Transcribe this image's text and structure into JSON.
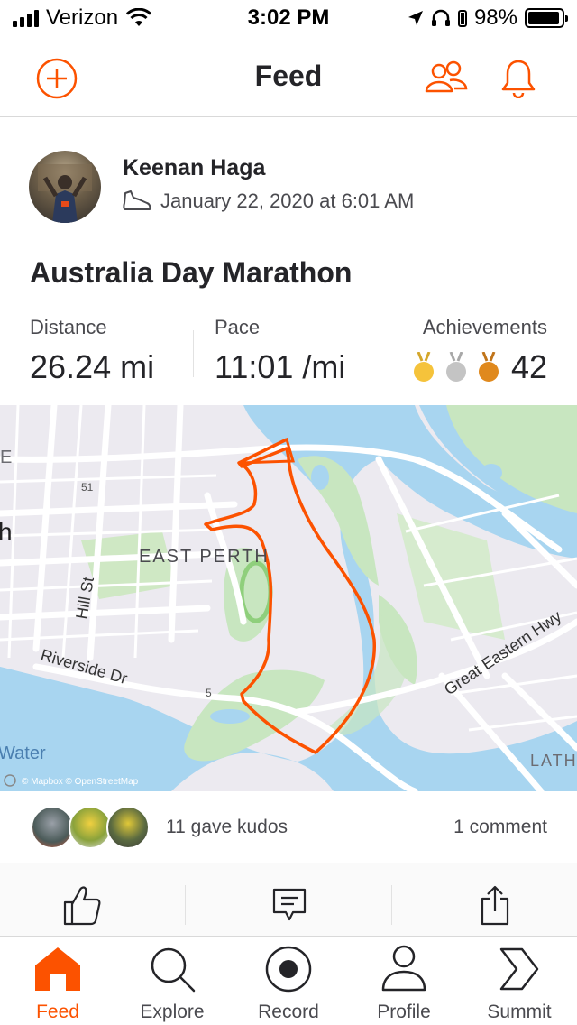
{
  "status_bar": {
    "carrier": "Verizon",
    "time": "3:02 PM",
    "battery": "98%"
  },
  "nav": {
    "title": "Feed",
    "add_icon": "plus-circle-icon",
    "friends_icon": "people-icon",
    "notifications_icon": "bell-icon"
  },
  "activity": {
    "athlete_name": "Keenan Haga",
    "date": "January 22, 2020 at 6:01 AM",
    "title": "Australia Day Marathon",
    "stats": {
      "distance_label": "Distance",
      "distance_value": "26.24 mi",
      "pace_label": "Pace",
      "pace_value": "11:01 /mi",
      "achievements_label": "Achievements",
      "achievements_value": "42"
    }
  },
  "map": {
    "labels": {
      "east_perth": "EAST PERTH",
      "hill_st": "Hill St",
      "riverside_dr": "Riverside Dr",
      "great_eastern_hwy": "Great Eastern Hwy",
      "water": "Water",
      "lath": "LATH",
      "route_51": "51",
      "route_5": "5",
      "edge_e": "E",
      "edge_h": "h",
      "attribution": "© Mapbox © OpenStreetMap"
    }
  },
  "social": {
    "kudos_text": "11 gave kudos",
    "comment_text": "1 comment"
  },
  "tabs": [
    {
      "label": "Feed",
      "icon": "home-icon",
      "active": true
    },
    {
      "label": "Explore",
      "icon": "search-icon",
      "active": false
    },
    {
      "label": "Record",
      "icon": "record-icon",
      "active": false
    },
    {
      "label": "Profile",
      "icon": "profile-icon",
      "active": false
    },
    {
      "label": "Summit",
      "icon": "summit-chevron-icon",
      "active": false
    }
  ],
  "colors": {
    "brand": "#fc5200",
    "gold": "#f5c33b",
    "silver": "#c0c0c0",
    "bronze": "#e0891d",
    "water": "#a8d5f0",
    "park": "#c8e6c0"
  }
}
